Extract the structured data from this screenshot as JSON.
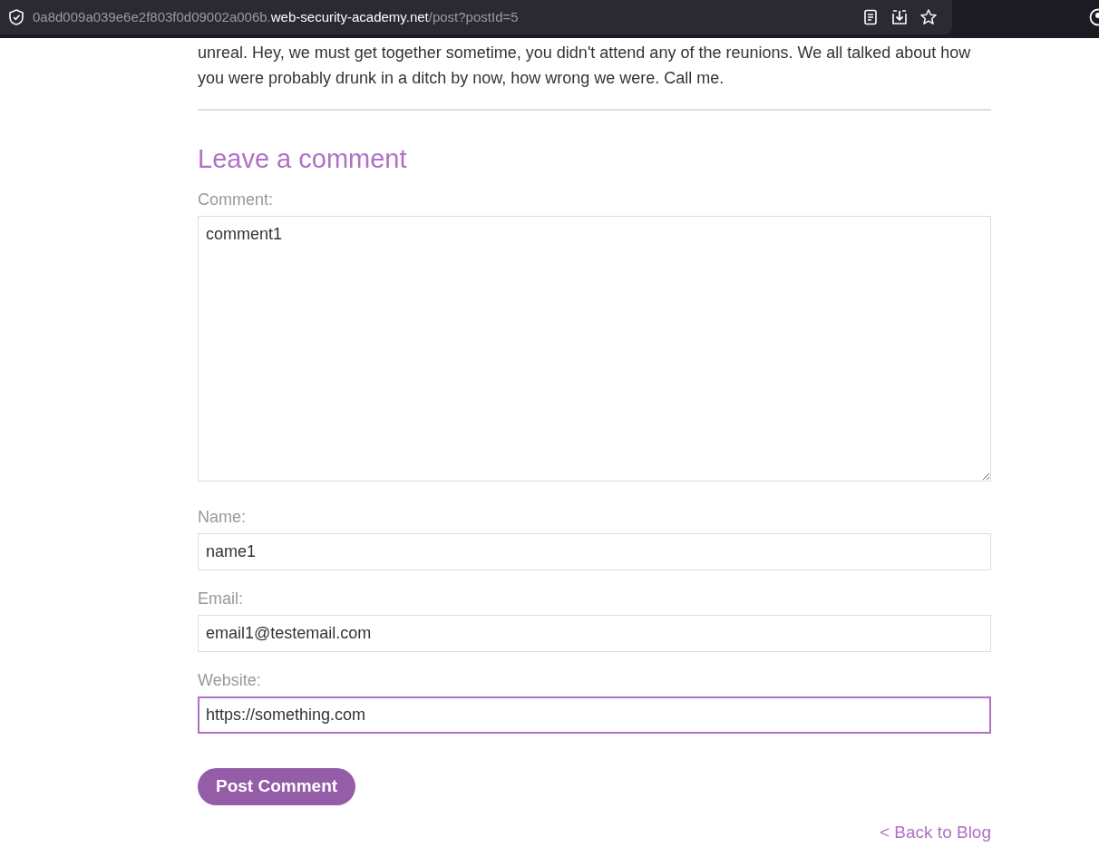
{
  "address_bar": {
    "subdomain": "0a8d009a039e6e2f803f0d09002a006b.",
    "domain": "web-security-academy.net",
    "path": "/post?postId=5"
  },
  "post_text": "unreal. Hey, we must get together sometime, you didn't attend any of the reunions. We all talked about how you were probably drunk in a ditch by now, how wrong we were. Call me.",
  "comment_form": {
    "heading": "Leave a comment",
    "fields": [
      {
        "kind": "textarea",
        "label": "Comment:",
        "value": "comment1",
        "focused": false
      },
      {
        "kind": "input",
        "label": "Name:",
        "value": "name1",
        "focused": false
      },
      {
        "kind": "input",
        "label": "Email:",
        "value": "email1@testemail.com",
        "focused": false
      },
      {
        "kind": "input",
        "label": "Website:",
        "value": "https://something.com",
        "focused": true
      }
    ],
    "submit": "Post Comment"
  },
  "back_link": "< Back to Blog"
}
